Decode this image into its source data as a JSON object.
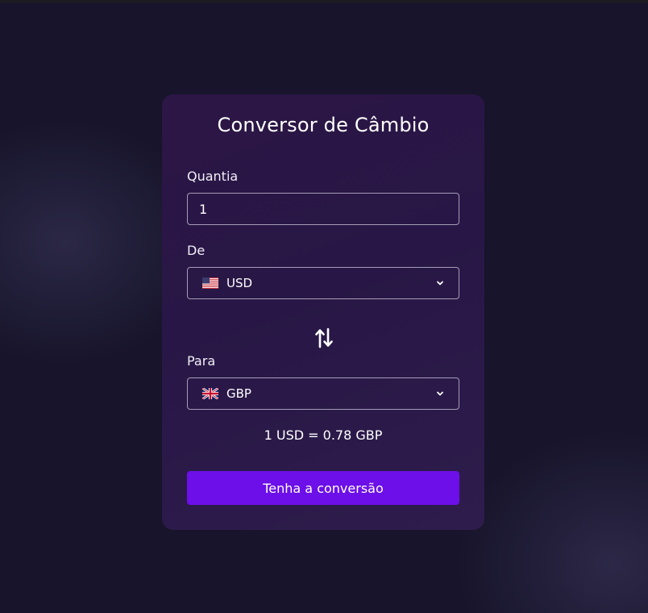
{
  "card": {
    "title": "Conversor de Câmbio"
  },
  "amount": {
    "label": "Quantia",
    "value": "1"
  },
  "from": {
    "label": "De",
    "flag_icon": "us-flag-icon",
    "currency": "USD"
  },
  "to": {
    "label": "Para",
    "flag_icon": "uk-flag-icon",
    "currency": "GBP"
  },
  "swap_icon": "swap-arrows-icon",
  "rate_text": "1 USD = 0.78 GBP",
  "convert_button": {
    "label": "Tenha a conversão"
  },
  "colors": {
    "background": "#17142b",
    "card": "#2a1746",
    "button": "#6c0fe8",
    "border": "#a49cb6"
  }
}
